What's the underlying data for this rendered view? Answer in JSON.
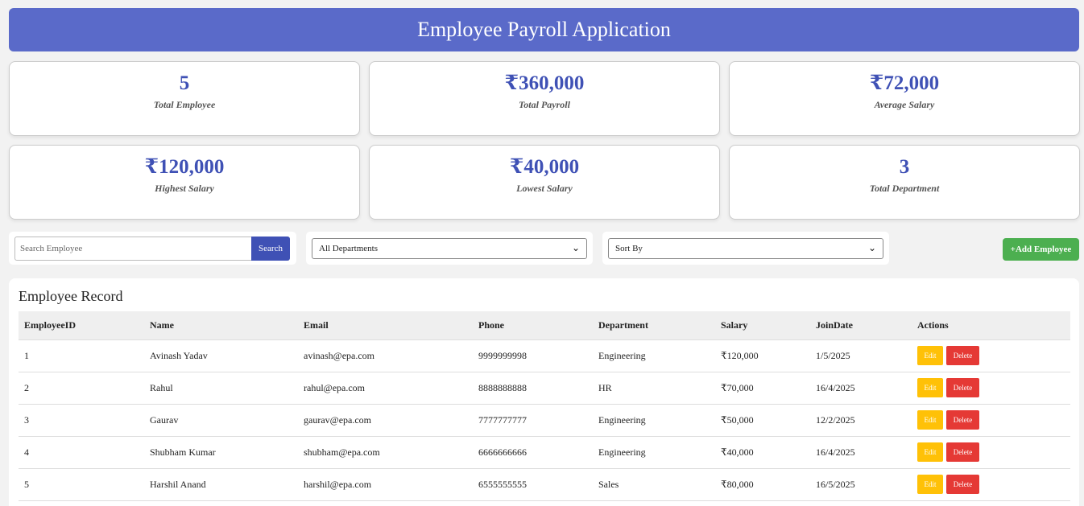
{
  "header": {
    "title": "Employee Payroll Application"
  },
  "stats": [
    {
      "value": "5",
      "label": "Total Employee"
    },
    {
      "value": "₹360,000",
      "label": "Total Payroll"
    },
    {
      "value": "₹72,000",
      "label": "Average Salary"
    },
    {
      "value": "₹120,000",
      "label": "Highest Salary"
    },
    {
      "value": "₹40,000",
      "label": "Lowest Salary"
    },
    {
      "value": "3",
      "label": "Total Department"
    }
  ],
  "toolbar": {
    "search_placeholder": "Search Employee",
    "search_button": "Search",
    "department_selected": "All Departments",
    "sort_selected": "Sort By",
    "add_button": "+Add Employee"
  },
  "records": {
    "title": "Employee Record",
    "columns": [
      "EmployeeID",
      "Name",
      "Email",
      "Phone",
      "Department",
      "Salary",
      "JoinDate",
      "Actions"
    ],
    "edit_label": "Edit",
    "delete_label": "Delete",
    "rows": [
      {
        "id": "1",
        "name": "Avinash Yadav",
        "email": "avinash@epa.com",
        "phone": "9999999998",
        "department": "Engineering",
        "salary": "₹120,000",
        "join_date": "1/5/2025"
      },
      {
        "id": "2",
        "name": "Rahul",
        "email": "rahul@epa.com",
        "phone": "8888888888",
        "department": "HR",
        "salary": "₹70,000",
        "join_date": "16/4/2025"
      },
      {
        "id": "3",
        "name": "Gaurav",
        "email": "gaurav@epa.com",
        "phone": "7777777777",
        "department": "Engineering",
        "salary": "₹50,000",
        "join_date": "12/2/2025"
      },
      {
        "id": "4",
        "name": "Shubham Kumar",
        "email": "shubham@epa.com",
        "phone": "6666666666",
        "department": "Engineering",
        "salary": "₹40,000",
        "join_date": "16/4/2025"
      },
      {
        "id": "5",
        "name": "Harshil Anand",
        "email": "harshil@epa.com",
        "phone": "6555555555",
        "department": "Sales",
        "salary": "₹80,000",
        "join_date": "16/5/2025"
      }
    ]
  }
}
